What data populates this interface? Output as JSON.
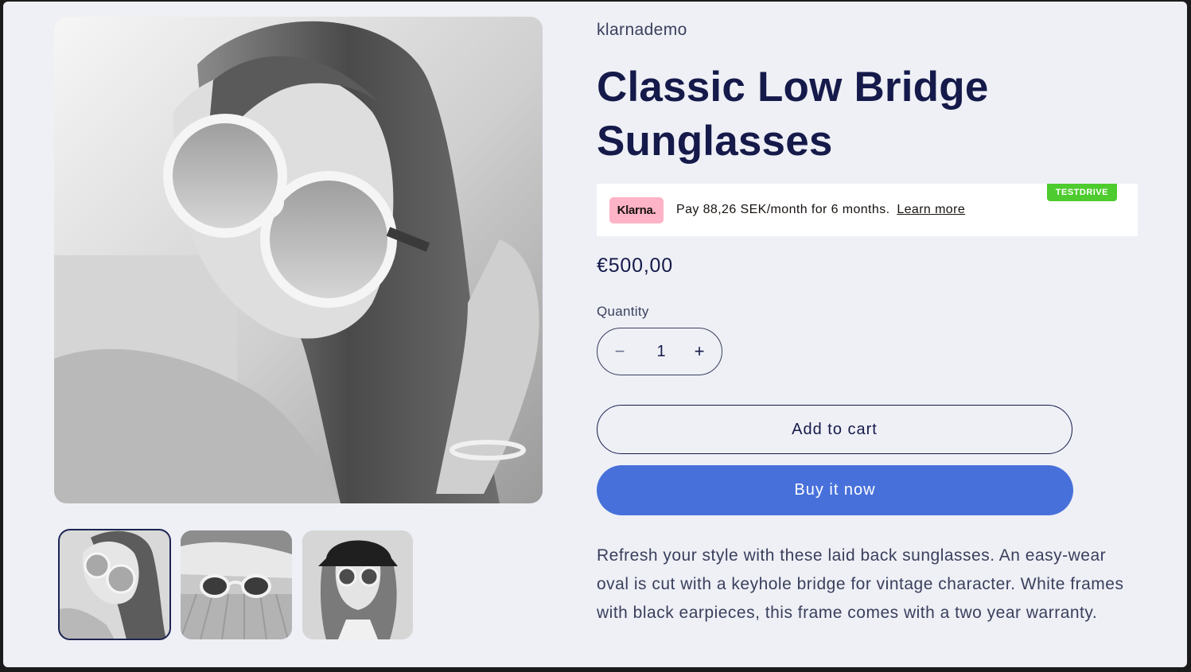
{
  "product": {
    "vendor": "klarnademo",
    "title": "Classic Low Bridge Sunglasses",
    "price": "€500,00",
    "description": "Refresh your style with these laid back sunglasses. An easy-wear oval is cut with a keyhole bridge for vintage character. White frames with black earpieces, this frame comes with a two year warranty."
  },
  "klarna": {
    "logo": "Klarna.",
    "message": "Pay 88,26 SEK/month for 6 months.",
    "learn_more": "Learn more",
    "badge": "TESTDRIVE"
  },
  "quantity": {
    "label": "Quantity",
    "value": "1",
    "minus": "−",
    "plus": "+"
  },
  "buttons": {
    "add_to_cart": "Add to cart",
    "buy_now": "Buy it now"
  },
  "media": {
    "main_image": "woman-in-white-round-sunglasses",
    "thumbnails": [
      "woman-in-white-round-sunglasses",
      "sunglasses-on-surface",
      "woman-with-beanie-and-sunglasses"
    ],
    "active_thumbnail": 1
  },
  "colors": {
    "accent": "#4770db",
    "text": "#151a4a",
    "background": "#eef0f6",
    "klarna_pink": "#ffb3c7",
    "badge_green": "#4ecb2e"
  }
}
